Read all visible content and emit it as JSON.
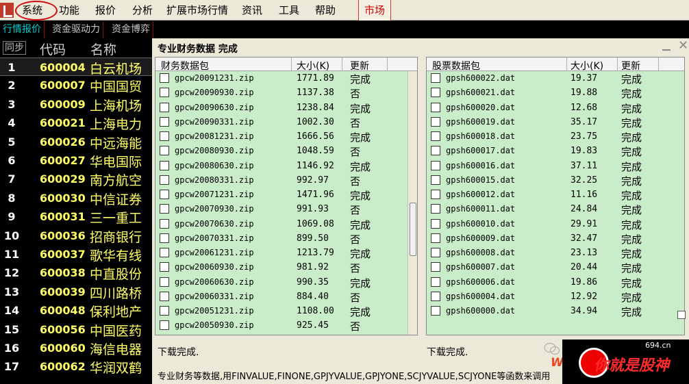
{
  "menubar": {
    "items": [
      "系统",
      "功能",
      "报价",
      "分析",
      "扩展市场行情",
      "资讯",
      "工具",
      "帮助"
    ],
    "market": "市场"
  },
  "tabs": [
    "行情报价",
    "资金驱动力",
    "资金博弈"
  ],
  "stocklist": {
    "sync": "同步",
    "col_code": "代码",
    "col_name": "名称",
    "rows": [
      {
        "idx": "1",
        "code": "600004",
        "name": "白云机场"
      },
      {
        "idx": "2",
        "code": "600007",
        "name": "中国国贸"
      },
      {
        "idx": "3",
        "code": "600009",
        "name": "上海机场"
      },
      {
        "idx": "4",
        "code": "600021",
        "name": "上海电力"
      },
      {
        "idx": "5",
        "code": "600026",
        "name": "中远海能"
      },
      {
        "idx": "6",
        "code": "600027",
        "name": "华电国际"
      },
      {
        "idx": "7",
        "code": "600029",
        "name": "南方航空"
      },
      {
        "idx": "8",
        "code": "600030",
        "name": "中信证券"
      },
      {
        "idx": "9",
        "code": "600031",
        "name": "三一重工"
      },
      {
        "idx": "10",
        "code": "600036",
        "name": "招商银行"
      },
      {
        "idx": "11",
        "code": "600037",
        "name": "歌华有线"
      },
      {
        "idx": "12",
        "code": "600038",
        "name": "中直股份"
      },
      {
        "idx": "13",
        "code": "600039",
        "name": "四川路桥"
      },
      {
        "idx": "14",
        "code": "600048",
        "name": "保利地产"
      },
      {
        "idx": "15",
        "code": "600056",
        "name": "中国医药"
      },
      {
        "idx": "16",
        "code": "600060",
        "name": "海信电器"
      },
      {
        "idx": "17",
        "code": "600062",
        "name": "华润双鹤"
      }
    ]
  },
  "dialog": {
    "title": "专业财务数据 完成",
    "left": {
      "col_name": "财务数据包",
      "col_size": "大小(K)",
      "col_status": "更新",
      "rows": [
        {
          "name": "gpcw20091231.zip",
          "size": "1771.89",
          "status": "完成"
        },
        {
          "name": "gpcw20090930.zip",
          "size": "1137.38",
          "status": "否"
        },
        {
          "name": "gpcw20090630.zip",
          "size": "1238.84",
          "status": "完成"
        },
        {
          "name": "gpcw20090331.zip",
          "size": "1002.30",
          "status": "否"
        },
        {
          "name": "gpcw20081231.zip",
          "size": "1666.56",
          "status": "完成"
        },
        {
          "name": "gpcw20080930.zip",
          "size": "1048.59",
          "status": "否"
        },
        {
          "name": "gpcw20080630.zip",
          "size": "1146.92",
          "status": "完成"
        },
        {
          "name": "gpcw20080331.zip",
          "size": "992.97",
          "status": "否"
        },
        {
          "name": "gpcw20071231.zip",
          "size": "1471.96",
          "status": "完成"
        },
        {
          "name": "gpcw20070930.zip",
          "size": "991.93",
          "status": "否"
        },
        {
          "name": "gpcw20070630.zip",
          "size": "1069.08",
          "status": "完成"
        },
        {
          "name": "gpcw20070331.zip",
          "size": "899.50",
          "status": "否"
        },
        {
          "name": "gpcw20061231.zip",
          "size": "1213.79",
          "status": "完成"
        },
        {
          "name": "gpcw20060930.zip",
          "size": "981.92",
          "status": "否"
        },
        {
          "name": "gpcw20060630.zip",
          "size": "990.35",
          "status": "完成"
        },
        {
          "name": "gpcw20060331.zip",
          "size": "884.40",
          "status": "否"
        },
        {
          "name": "gpcw20051231.zip",
          "size": "1108.00",
          "status": "完成"
        },
        {
          "name": "gpcw20050930.zip",
          "size": "925.45",
          "status": "否"
        }
      ]
    },
    "right": {
      "col_name": "股票数据包",
      "col_size": "大小(K)",
      "col_status": "更新",
      "rows": [
        {
          "name": "gpsh600022.dat",
          "size": "19.37",
          "status": "完成"
        },
        {
          "name": "gpsh600021.dat",
          "size": "19.88",
          "status": "完成"
        },
        {
          "name": "gpsh600020.dat",
          "size": "12.68",
          "status": "完成"
        },
        {
          "name": "gpsh600019.dat",
          "size": "35.17",
          "status": "完成"
        },
        {
          "name": "gpsh600018.dat",
          "size": "23.75",
          "status": "完成"
        },
        {
          "name": "gpsh600017.dat",
          "size": "19.83",
          "status": "完成"
        },
        {
          "name": "gpsh600016.dat",
          "size": "37.11",
          "status": "完成"
        },
        {
          "name": "gpsh600015.dat",
          "size": "32.25",
          "status": "完成"
        },
        {
          "name": "gpsh600012.dat",
          "size": "11.16",
          "status": "完成"
        },
        {
          "name": "gpsh600011.dat",
          "size": "24.84",
          "status": "完成"
        },
        {
          "name": "gpsh600010.dat",
          "size": "29.91",
          "status": "完成"
        },
        {
          "name": "gpsh600009.dat",
          "size": "32.47",
          "status": "完成"
        },
        {
          "name": "gpsh600008.dat",
          "size": "23.13",
          "status": "完成"
        },
        {
          "name": "gpsh600007.dat",
          "size": "20.44",
          "status": "完成"
        },
        {
          "name": "gpsh600006.dat",
          "size": "19.86",
          "status": "完成"
        },
        {
          "name": "gpsh600004.dat",
          "size": "12.92",
          "status": "完成"
        },
        {
          "name": "gpsh600000.dat",
          "size": "34.94",
          "status": "完成"
        }
      ]
    },
    "status_left": "下载完成.",
    "status_right": "下载完成.",
    "help": "专业财务等数据,用FINVALUE,FINONE,GPJYVALUE,GPJYONE,SCJYVALUE,SCJYONE等函数来调用"
  },
  "watermark": {
    "site": "694.cn",
    "ww": "WW",
    "text": "你就是股神"
  }
}
